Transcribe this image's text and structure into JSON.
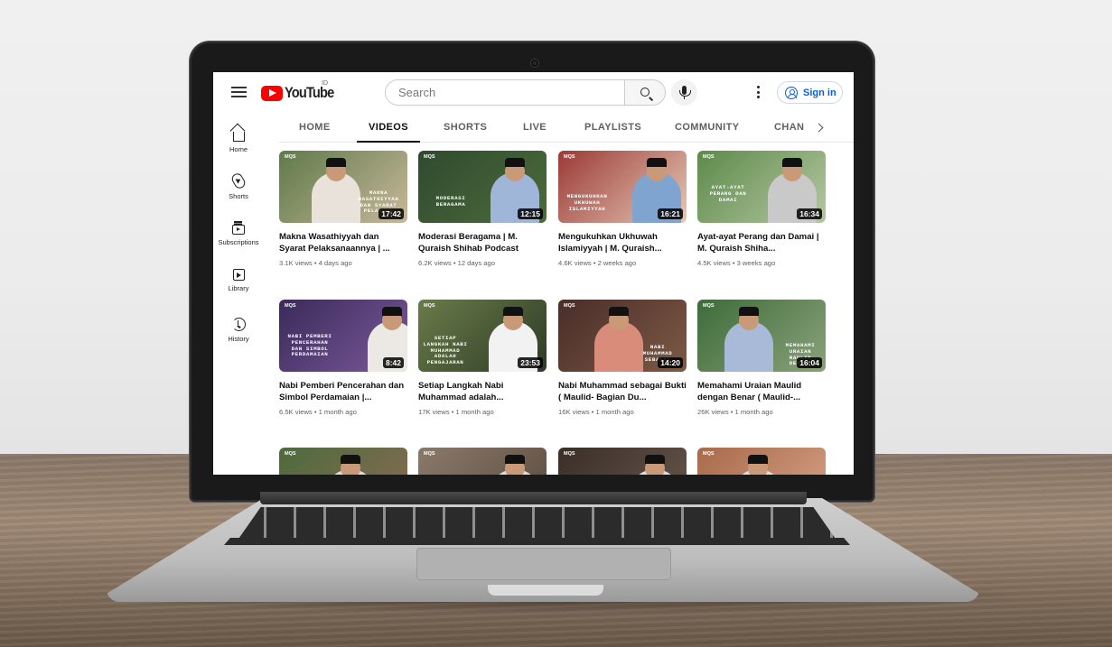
{
  "header": {
    "logo_text": "YouTube",
    "region": "ID",
    "search_placeholder": "Search",
    "signin_label": "Sign in"
  },
  "sidebar": {
    "items": [
      {
        "label": "Home",
        "icon": "home-icon"
      },
      {
        "label": "Shorts",
        "icon": "shorts-icon"
      },
      {
        "label": "Subscriptions",
        "icon": "subscriptions-icon"
      },
      {
        "label": "Library",
        "icon": "library-icon"
      },
      {
        "label": "History",
        "icon": "history-icon"
      }
    ]
  },
  "tabs": [
    {
      "label": "HOME",
      "active": false
    },
    {
      "label": "VIDEOS",
      "active": true
    },
    {
      "label": "SHORTS",
      "active": false
    },
    {
      "label": "LIVE",
      "active": false
    },
    {
      "label": "PLAYLISTS",
      "active": false
    },
    {
      "label": "COMMUNITY",
      "active": false
    },
    {
      "label": "CHAN",
      "active": false
    }
  ],
  "videos": [
    {
      "title": "Makna Wasathiyyah dan Syarat Pelaksanaannya | ...",
      "meta": "3.1K views • 4 days ago",
      "duration": "17:42",
      "caption": "MAKNA WASATHIYYAH DAN SYARAT PELAKSAN",
      "brand": "MQS"
    },
    {
      "title": "Moderasi Beragama | M. Quraish Shihab Podcast",
      "meta": "6.2K views • 12 days ago",
      "duration": "12:15",
      "caption": "MODERASI BERAGAMA",
      "brand": "MQS"
    },
    {
      "title": "Mengukuhkan Ukhuwah Islamiyyah | M. Quraish...",
      "meta": "4.6K views • 2 weeks ago",
      "duration": "16:21",
      "caption": "MENGUKUHKAN UKHUWAH ISLAMIYYAH",
      "brand": "MQS"
    },
    {
      "title": "Ayat-ayat Perang dan Damai | M. Quraish Shiha...",
      "meta": "4.5K views • 3 weeks ago",
      "duration": "16:34",
      "caption": "AYAT-AYAT PERANG DAN DAMAI",
      "brand": "MQS"
    },
    {
      "title": "Nabi Pemberi Pencerahan dan Simbol Perdamaian |...",
      "meta": "6.5K views • 1 month ago",
      "duration": "8:42",
      "caption": "NABI PEMBERI PENCERAHAN DAN SIMBOL PERDAMAIAN",
      "brand": "MQS"
    },
    {
      "title": "Setiap Langkah Nabi Muhammad adalah...",
      "meta": "17K views • 1 month ago",
      "duration": "23:53",
      "caption": "SETIAP LANGKAH NABI MUHAMMAD ADALAH PENGAJARAN",
      "brand": "MQS"
    },
    {
      "title": "Nabi Muhammad sebagai Bukti ( Maulid- Bagian Du...",
      "meta": "16K views • 1 month ago",
      "duration": "14:20",
      "caption": "NABI MUHAMMAD SEBAGAI",
      "brand": "MQS"
    },
    {
      "title": "Memahami Uraian Maulid dengan Benar ( Maulid-...",
      "meta": "26K views • 1 month ago",
      "duration": "16:04",
      "caption": "MEMAHAMI URAIAN MAULID DENGAN",
      "brand": "MQS"
    },
    {
      "title": "",
      "meta": "",
      "duration": "",
      "caption": "",
      "brand": "MQS"
    },
    {
      "title": "",
      "meta": "",
      "duration": "",
      "caption": "",
      "brand": "MQS"
    },
    {
      "title": "",
      "meta": "",
      "duration": "",
      "caption": "",
      "brand": "MQS"
    },
    {
      "title": "",
      "meta": "",
      "duration": "",
      "caption": "",
      "brand": "MQS"
    }
  ],
  "colors": {
    "brand_red": "#ff0000",
    "signin_blue": "#065fd4",
    "text_primary": "#0f0f0f",
    "text_secondary": "#606060"
  }
}
